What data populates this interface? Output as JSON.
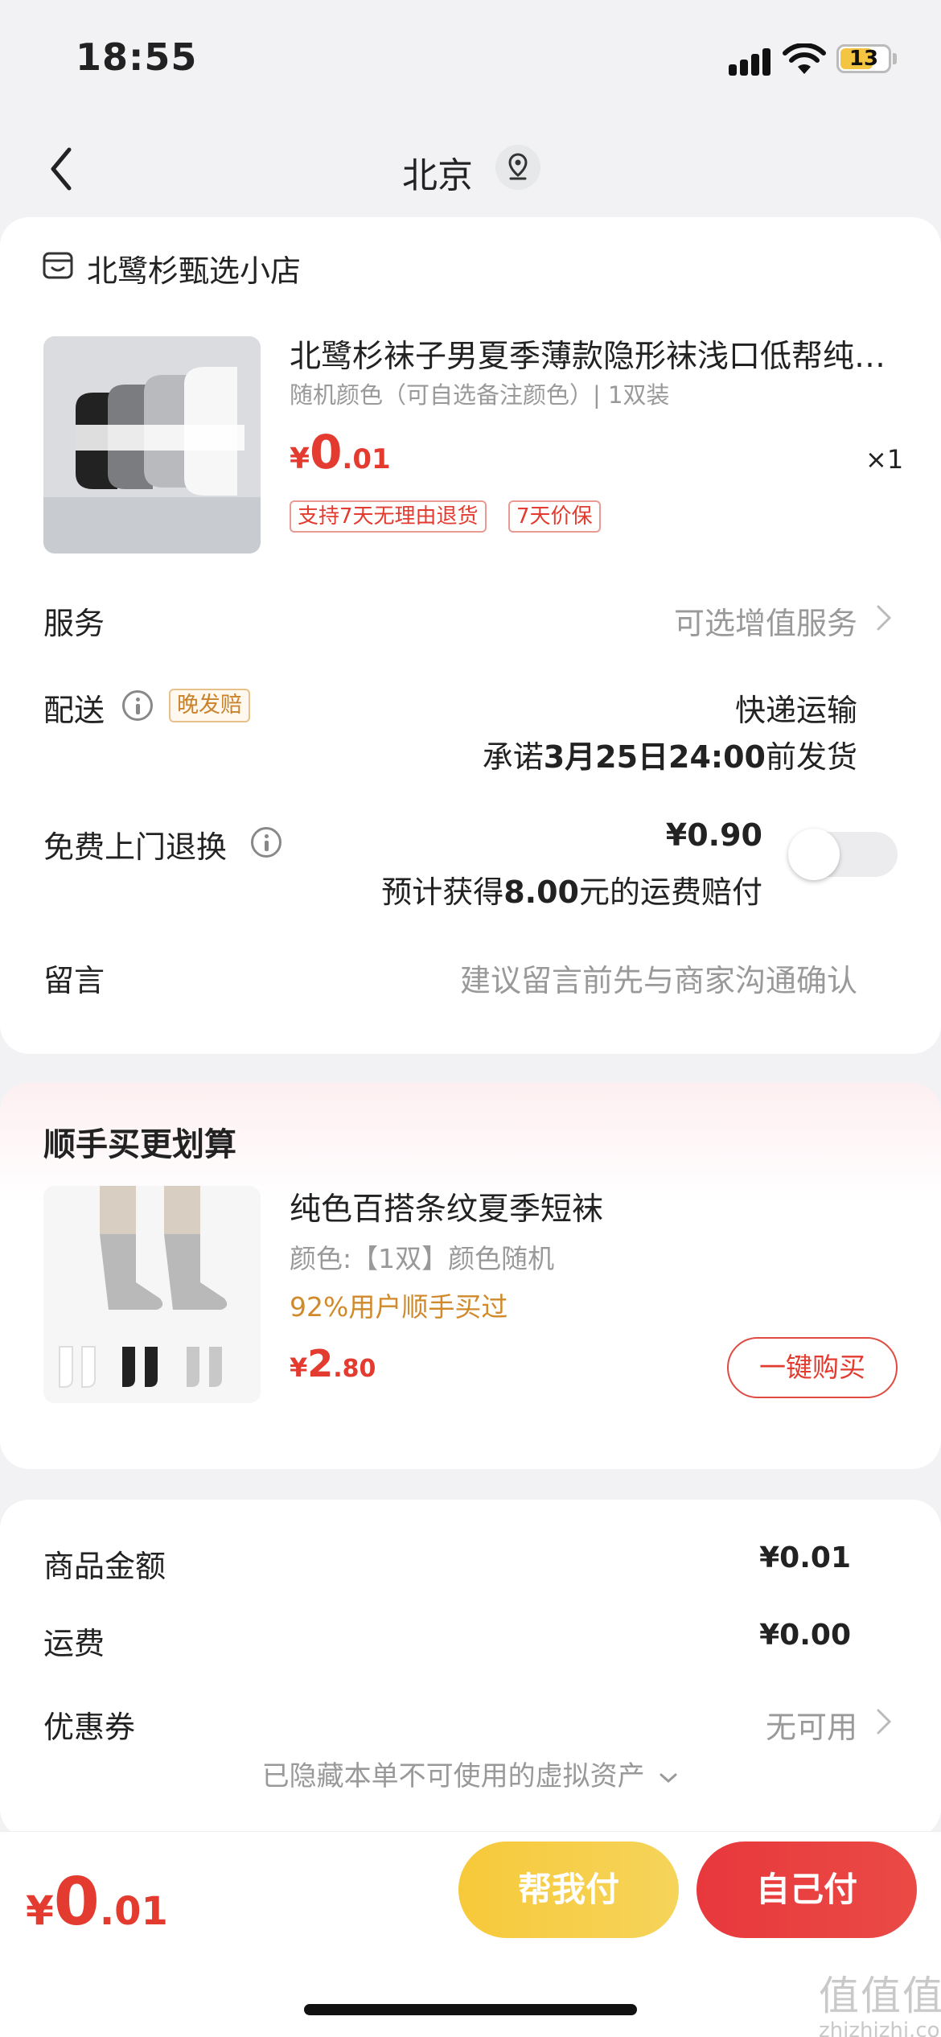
{
  "status": {
    "time": "18:55",
    "battery": "13"
  },
  "nav": {
    "title": "北京"
  },
  "shop": {
    "name": "北鹭杉甄选小店"
  },
  "product": {
    "title": "北鹭杉袜子男夏季薄款隐形袜浅口低帮纯色船袜",
    "spec": "随机颜色（可自选备注颜色）| 1双装",
    "price_currency": "¥",
    "price_int": "0",
    "price_dec": ".01",
    "qty": "×1",
    "tags": [
      "支持7天无理由退货",
      "7天价保"
    ]
  },
  "service": {
    "label": "服务",
    "value": "可选增值服务"
  },
  "delivery": {
    "label": "配送",
    "tag": "晚发赔",
    "method": "快递运输",
    "promise_prefix": "承诺",
    "promise_date": "3月25日24:00",
    "promise_suffix": "前发货"
  },
  "return_service": {
    "label": "免费上门退换",
    "price": "¥0.90",
    "note_prefix": "预计获得",
    "note_amount": "8.00",
    "note_suffix": "元的运费赔付",
    "enabled": false
  },
  "message": {
    "label": "留言",
    "placeholder": "建议留言前先与商家沟通确认"
  },
  "recommend": {
    "section_title": "顺手买更划算",
    "title": "纯色百搭条纹夏季短袜",
    "spec": "颜色:【1双】颜色随机",
    "social": "92%用户顺手买过",
    "price_currency": "¥",
    "price_int": "2",
    "price_dec": ".80",
    "button": "一键购买"
  },
  "summary": {
    "goods_label": "商品金额",
    "goods_value": "¥0.01",
    "shipping_label": "运费",
    "shipping_value": "¥0.00",
    "coupon_label": "优惠券",
    "coupon_value": "无可用",
    "hidden_note": "已隐藏本单不可使用的虚拟资产"
  },
  "bottom": {
    "total_currency": "¥",
    "total_int": "0",
    "total_dec": ".01",
    "help_pay": "帮我付",
    "self_pay": "自己付"
  },
  "watermark": {
    "big": "值值值",
    "small": "zhizhizhi.com"
  },
  "colors": {
    "accent": "#e33b2f",
    "gold": "#d18a2b",
    "help_pay": "#f7c93a"
  }
}
